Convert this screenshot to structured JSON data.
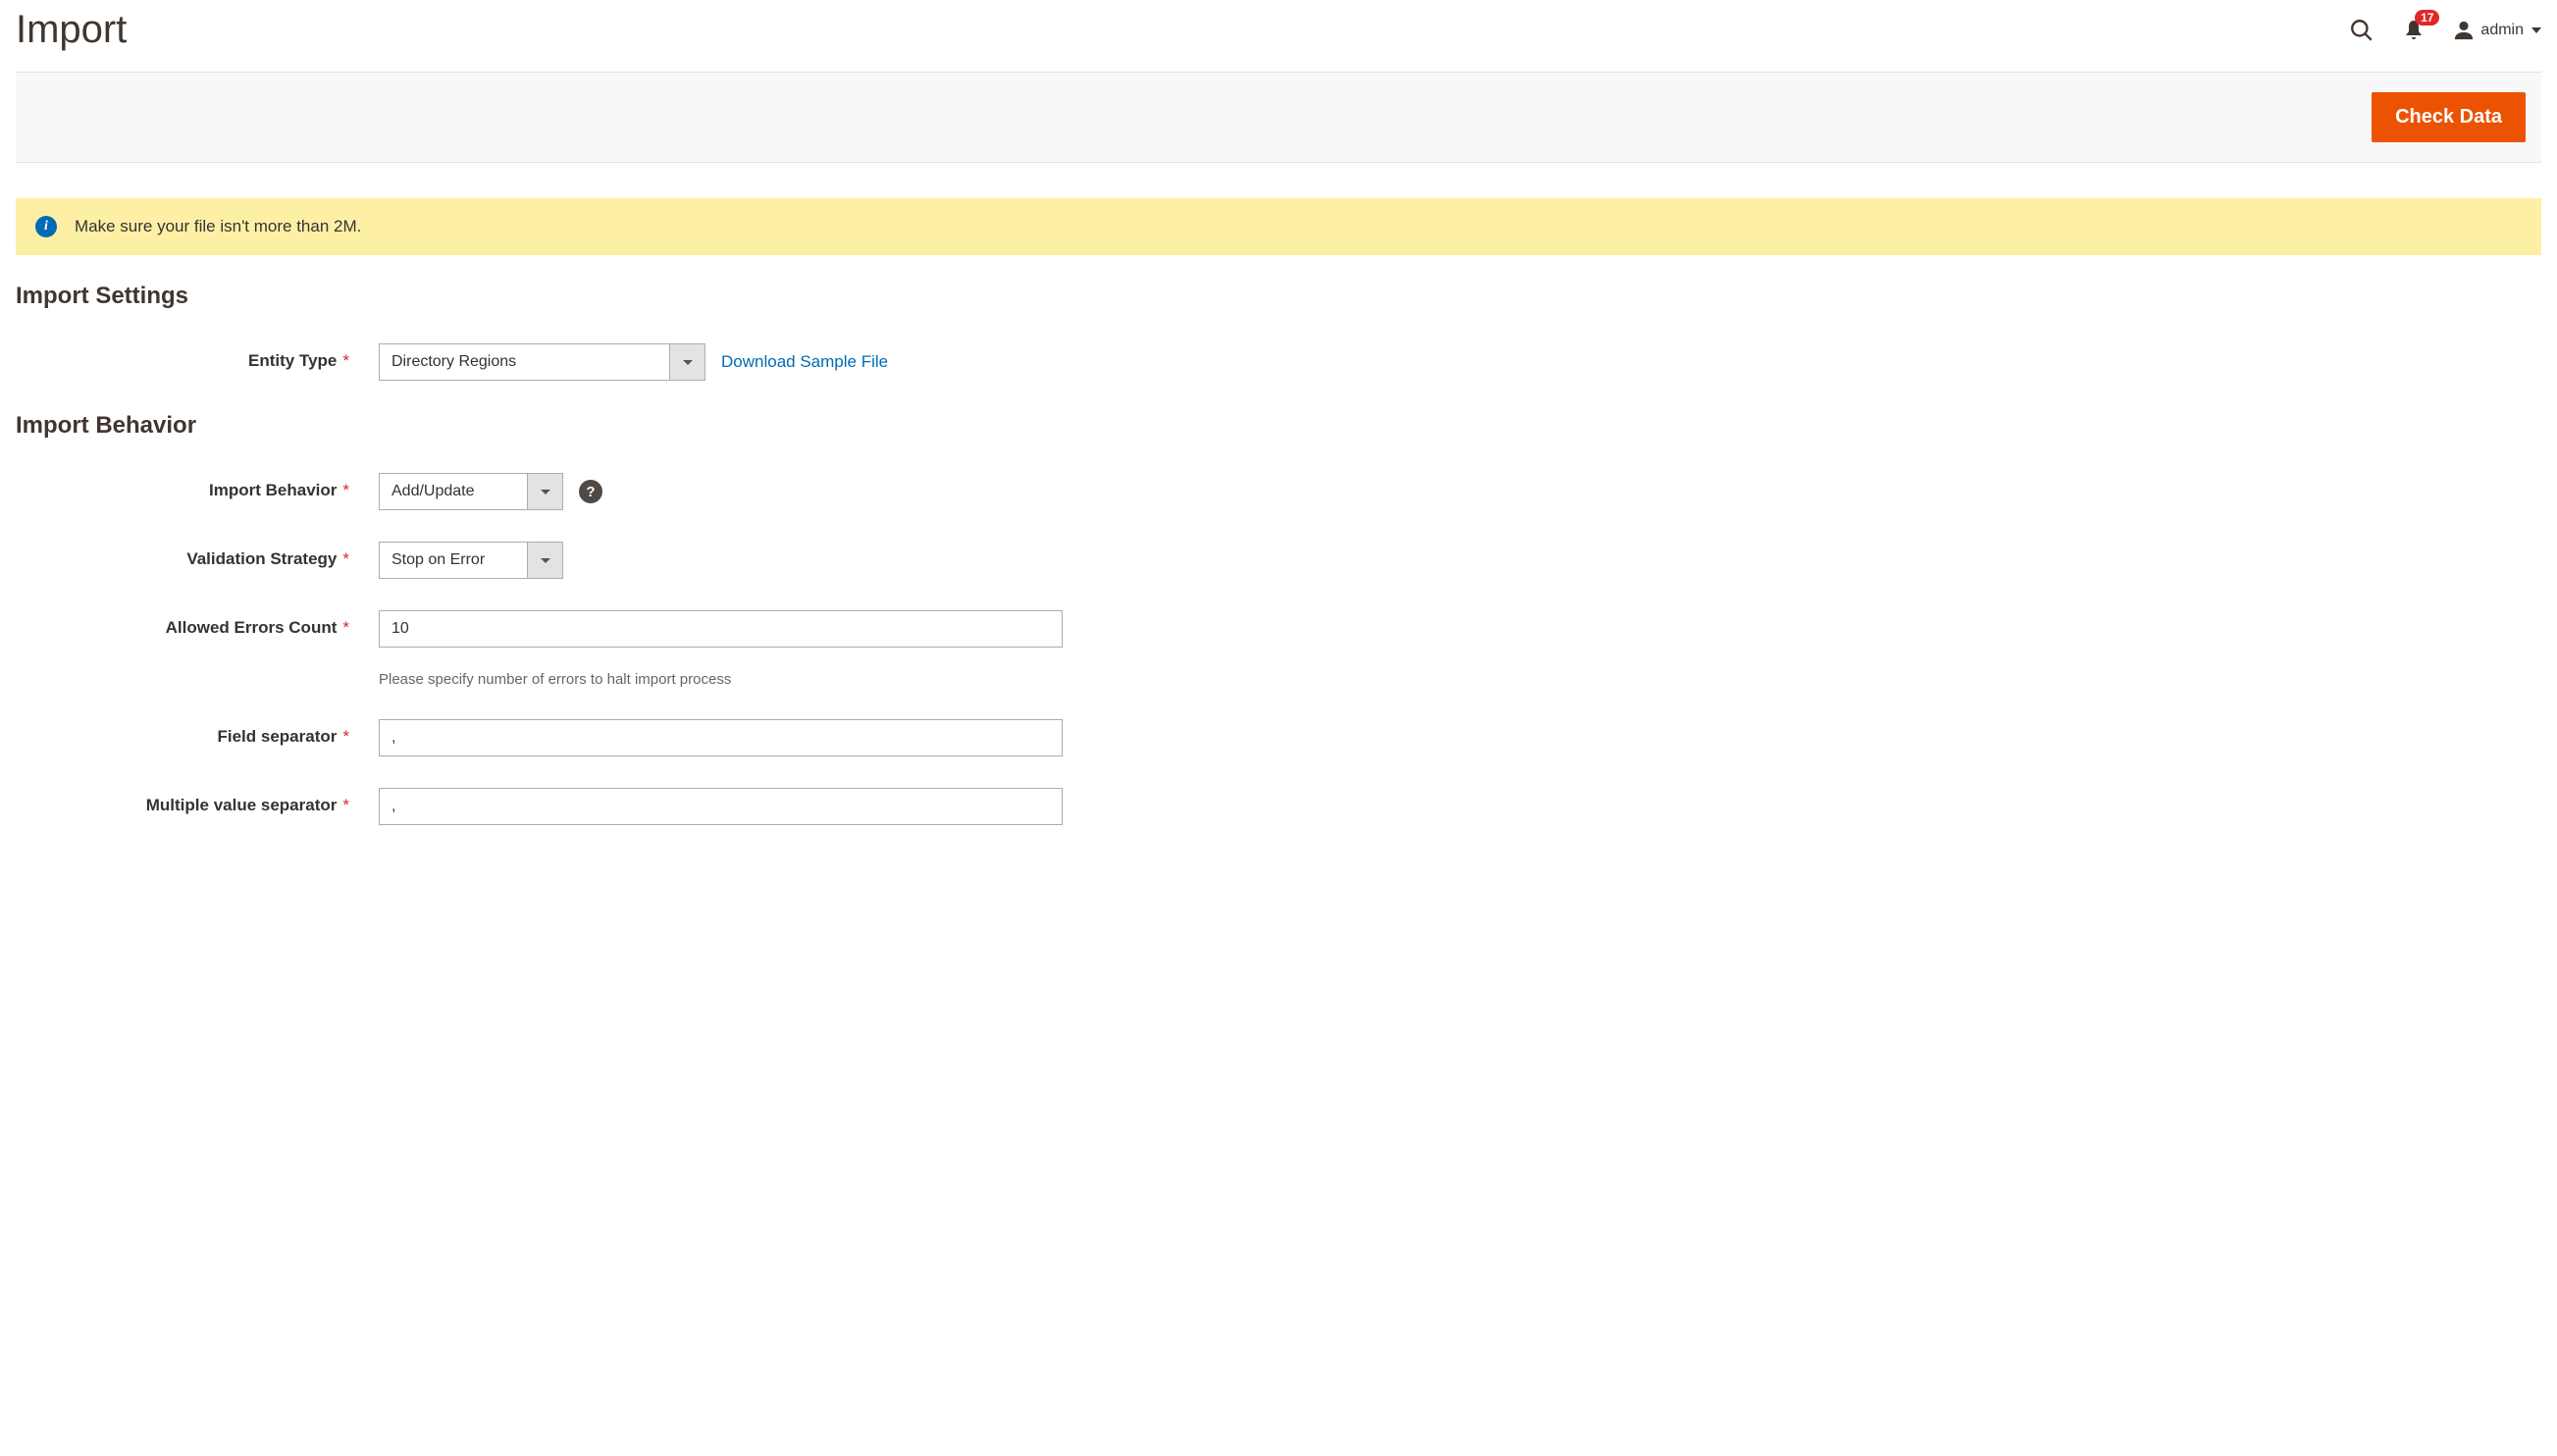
{
  "header": {
    "title": "Import",
    "notification_count": "17",
    "username": "admin"
  },
  "actions": {
    "check_data_label": "Check Data"
  },
  "messages": {
    "file_size_info": "Make sure your file isn't more than 2M."
  },
  "sections": {
    "import_settings_title": "Import Settings",
    "import_behavior_title": "Import Behavior"
  },
  "fields": {
    "entity_type": {
      "label": "Entity Type",
      "value": "Directory Regions",
      "sample_link": "Download Sample File"
    },
    "import_behavior": {
      "label": "Import Behavior",
      "value": "Add/Update"
    },
    "validation_strategy": {
      "label": "Validation Strategy",
      "value": "Stop on Error"
    },
    "allowed_errors": {
      "label": "Allowed Errors Count",
      "value": "10",
      "note": "Please specify number of errors to halt import process"
    },
    "field_separator": {
      "label": "Field separator",
      "value": ","
    },
    "multi_value_separator": {
      "label": "Multiple value separator",
      "value": ","
    }
  }
}
